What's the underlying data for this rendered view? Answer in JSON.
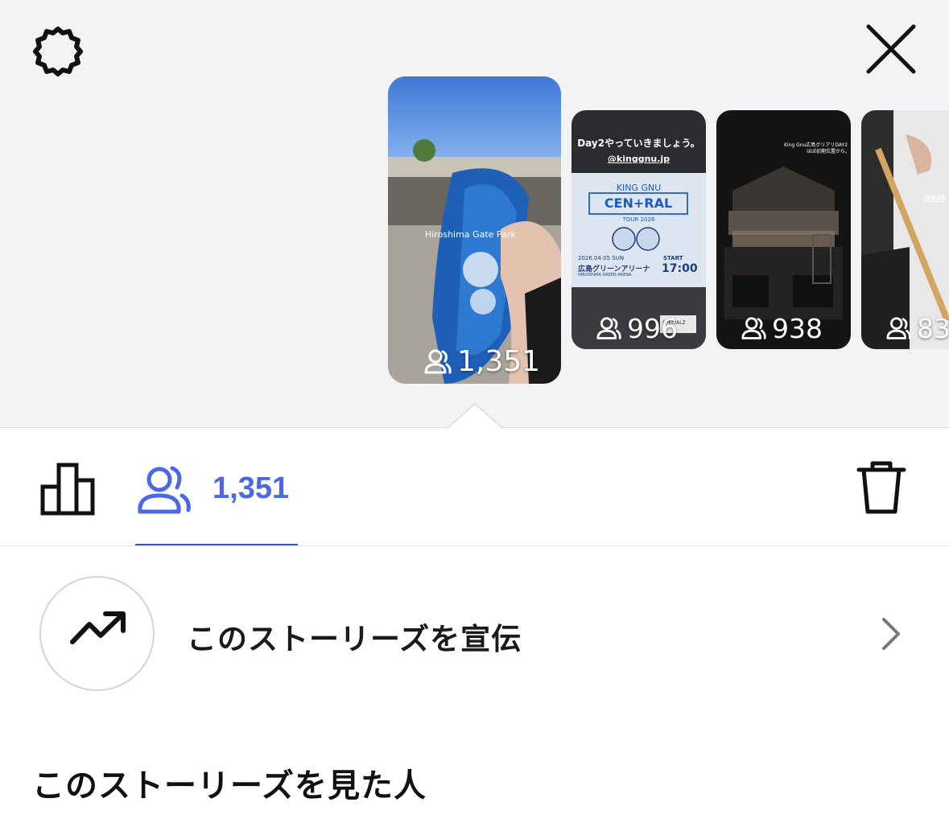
{
  "header": {
    "settings_icon": "settings-gear-icon",
    "close_icon": "close-x-icon"
  },
  "stories": [
    {
      "views": "1,351",
      "location_tag": "Hiroshima Gate Park",
      "selected": true
    },
    {
      "views": "996",
      "caption": "Day2やっていきましょう。",
      "handle": "@kinggnu.jp",
      "poster_band": "KING GNU",
      "poster_title": "CEN+RAL",
      "poster_tour": "TOUR 2026",
      "poster_date": "2026.04.05 SUN",
      "poster_venue": "広島グリーンアリーナ",
      "poster_venue_en": "HIROSHIMA GREEN ARENA",
      "poster_start_label": "START",
      "poster_start_time": "17:00",
      "sponsor": "SPECIALZ"
    },
    {
      "views": "938",
      "caption_line1": "King Gnu広島グリアリDAY2",
      "caption_line2": "ほぼ初期位置から。"
    },
    {
      "views": "83",
      "handle": "@kin"
    }
  ],
  "toolbar": {
    "insights_icon": "bar-chart-icon",
    "viewers_icon": "viewers-icon",
    "viewers_count": "1,351",
    "delete_icon": "trash-icon",
    "accent_color": "#4a68e8"
  },
  "promote": {
    "icon": "trending-up-icon",
    "label": "このストーリーズを宣伝",
    "chevron_icon": "chevron-right-icon"
  },
  "viewers_section": {
    "title": "このストーリーズを見た人"
  }
}
